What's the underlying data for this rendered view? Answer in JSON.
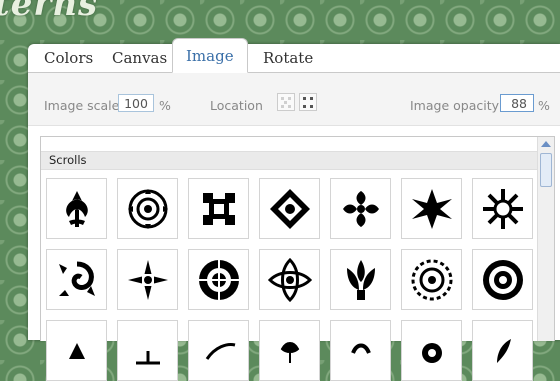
{
  "logo_text": "terns",
  "tabs": [
    {
      "label": "Colors",
      "active": false
    },
    {
      "label": "Canvas",
      "active": false
    },
    {
      "label": "Image",
      "active": true
    },
    {
      "label": "Rotate",
      "active": false
    }
  ],
  "controls": {
    "image_scale_label": "Image scale",
    "image_scale_value": "100",
    "image_scale_unit": "%",
    "location_label": "Location",
    "image_opacity_label": "Image opacity",
    "image_opacity_value": "88",
    "image_opacity_unit": "%"
  },
  "category": "Scrolls",
  "patterns": [
    "fleur-pattern-icon",
    "circle-rosette-pattern-icon",
    "square-knot-pattern-icon",
    "diamond-scroll-pattern-icon",
    "cross-scroll-pattern-icon",
    "star-burst-pattern-icon",
    "snowflake-pattern-icon",
    "spiral-pattern-icon",
    "diamond-cross-pattern-icon",
    "rosette-pattern-icon",
    "knot-circle-pattern-icon",
    "flame-pattern-icon",
    "ring-rosette-pattern-icon",
    "lace-circle-pattern-icon",
    "spade-pattern-icon",
    "small-ornament-pattern-icon",
    "swirl-pattern-icon",
    "bird-pattern-icon",
    "curl-pattern-icon",
    "round-drop-pattern-icon",
    "feather-pattern-icon"
  ],
  "colors": {
    "accent": "#3a6fa8",
    "background": "#5c8a5c"
  }
}
